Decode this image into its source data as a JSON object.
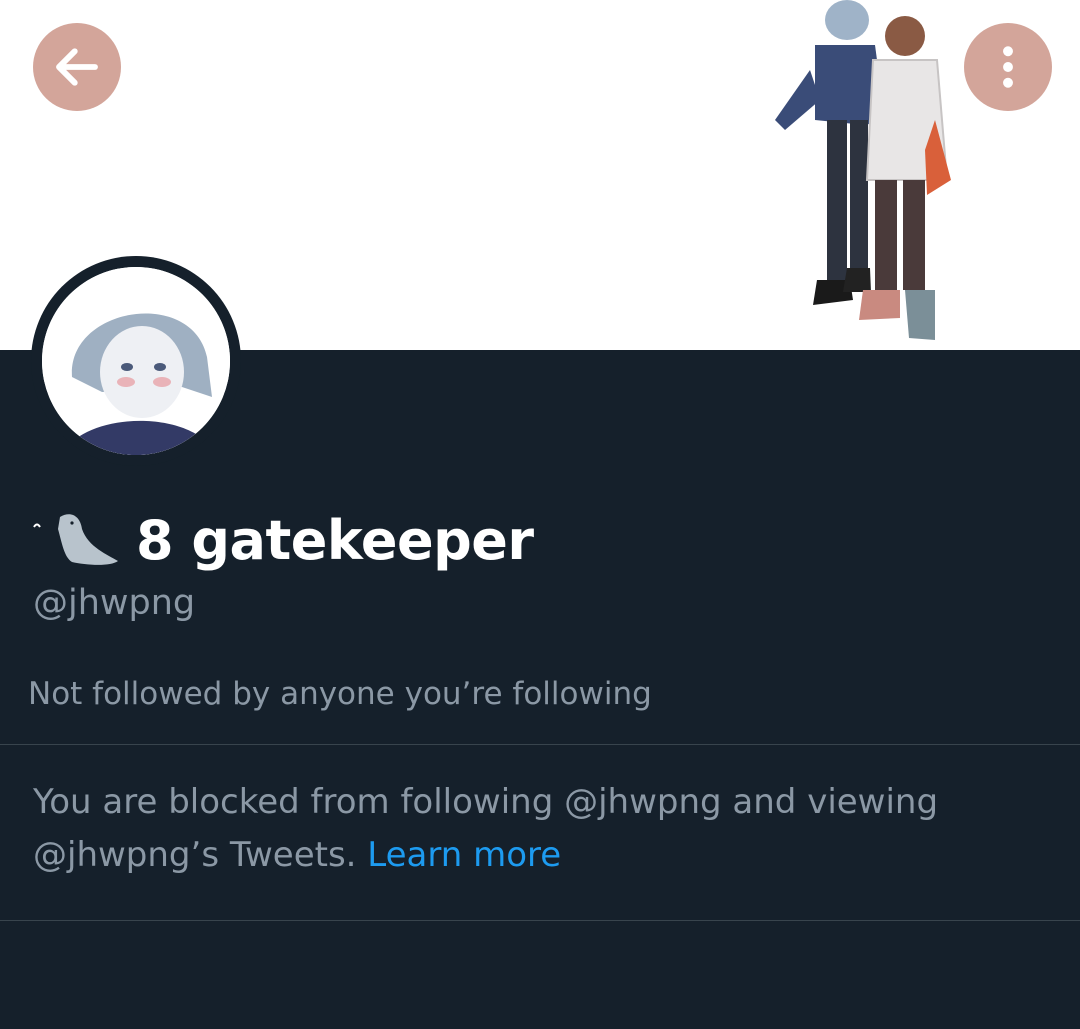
{
  "header": {
    "back_icon": "arrow-left-icon",
    "more_icon": "vertical-dots-icon"
  },
  "profile": {
    "display_name": "8 gatekeeper",
    "name_emoji": "seal-emoji",
    "handle": "@jhwpng",
    "followed_by": "Not followed by anyone you’re following"
  },
  "blocked_notice": {
    "text": "You are blocked from following @jhwpng and viewing @jhwpng’s Tweets. ",
    "link_label": "Learn more"
  },
  "colors": {
    "background": "#15202b",
    "banner": "#ffffff",
    "nav_button": "#d3a59a",
    "text_primary": "#ffffff",
    "text_secondary": "#8b98a5",
    "link": "#1d9bf0",
    "divider": "#38444d"
  }
}
